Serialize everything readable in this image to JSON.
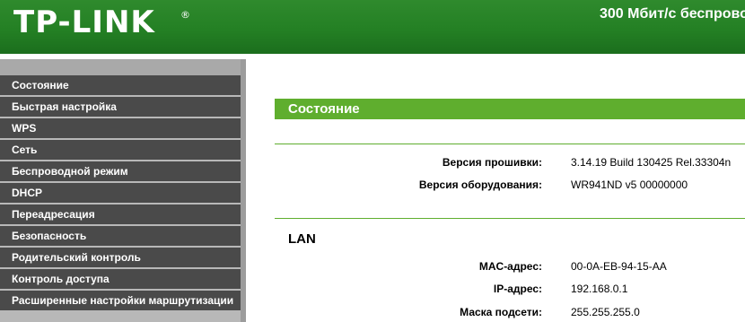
{
  "header": {
    "logo": "TP-LINK",
    "logo_reg": "®",
    "product_title": "300 Мбит/с беспрово"
  },
  "sidebar": {
    "items": [
      {
        "label": "Состояние"
      },
      {
        "label": "Быстрая настройка"
      },
      {
        "label": "WPS"
      },
      {
        "label": "Сеть"
      },
      {
        "label": "Беспроводной режим"
      },
      {
        "label": "DHCP"
      },
      {
        "label": "Переадресация"
      },
      {
        "label": "Безопасность"
      },
      {
        "label": "Родительский контроль"
      },
      {
        "label": "Контроль доступа"
      },
      {
        "label": "Расширенные настройки маршрутизации"
      }
    ]
  },
  "main": {
    "section_title": "Состояние",
    "firmware_label": "Версия прошивки:",
    "firmware_value": "3.14.19 Build 130425 Rel.33304n",
    "hardware_label": "Версия оборудования:",
    "hardware_value": "WR941ND v5 00000000",
    "lan_heading": "LAN",
    "mac_label": "MAC-адрес:",
    "mac_value": "00-0A-EB-94-15-AA",
    "ip_label": "IP-адрес:",
    "ip_value": "192.168.0.1",
    "mask_label": "Маска подсети:",
    "mask_value": "255.255.255.0"
  },
  "colors": {
    "header_green": "#248024",
    "section_green": "#5fae2e",
    "menu_dark": "#4a4a4a"
  }
}
